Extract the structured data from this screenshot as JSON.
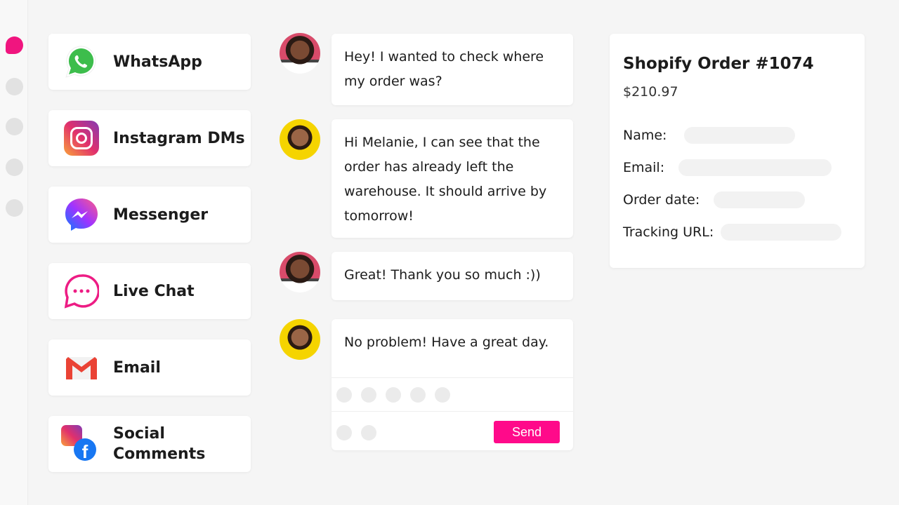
{
  "channels": [
    {
      "label": "WhatsApp",
      "icon": "whatsapp-icon"
    },
    {
      "label": "Instagram DMs",
      "icon": "instagram-icon"
    },
    {
      "label": "Messenger",
      "icon": "messenger-icon"
    },
    {
      "label": "Live Chat",
      "icon": "live-chat-icon"
    },
    {
      "label": "Email",
      "icon": "gmail-icon"
    },
    {
      "label": "Social Comments",
      "icon": "social-comments-icon"
    }
  ],
  "messages": [
    {
      "text": "Hey! I wanted to check where my order was?",
      "sender": "customer"
    },
    {
      "text": "Hi Melanie, I can see that the order has already left the warehouse. It should arrive by tomorrow!",
      "sender": "agent"
    },
    {
      "text": "Great! Thank you so much :))",
      "sender": "customer"
    },
    {
      "text": "No problem! Have a great day.",
      "sender": "agent"
    }
  ],
  "composer": {
    "send_label": "Send"
  },
  "order": {
    "title": "Shopify Order #1074",
    "price": "$210.97",
    "fields": [
      "Name:",
      "Email:",
      "Order date:",
      "Tracking URL:"
    ]
  },
  "colors": {
    "accent": "#ff0a8a"
  }
}
